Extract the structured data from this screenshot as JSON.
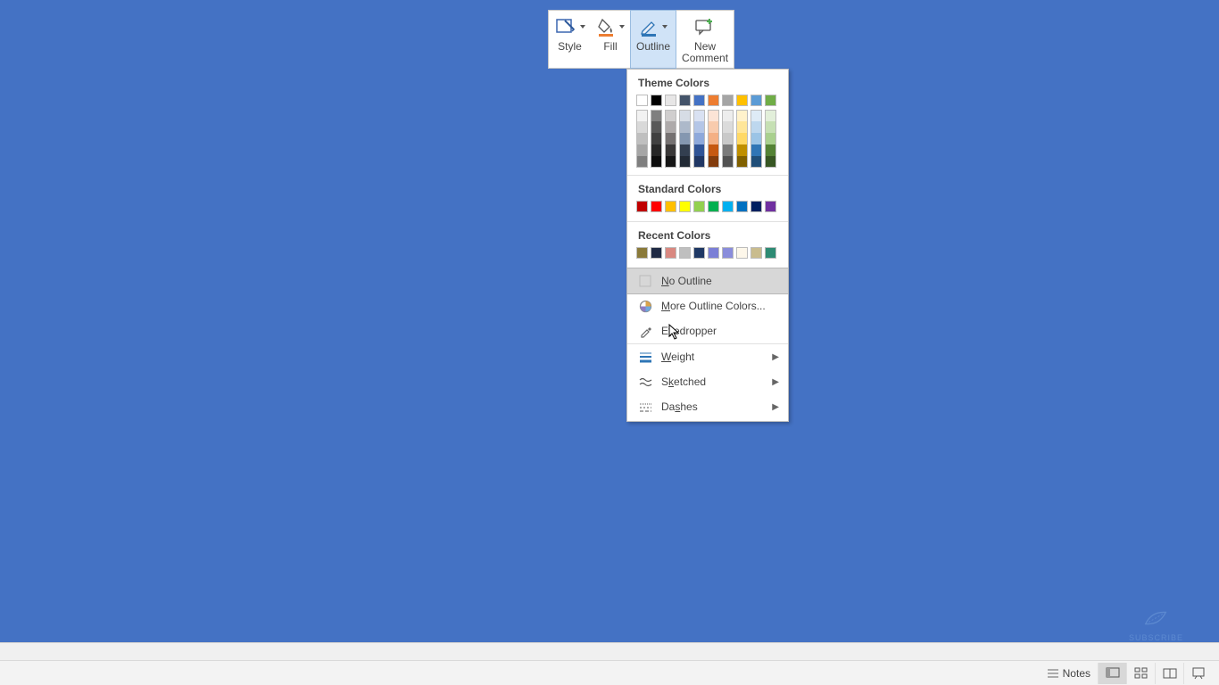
{
  "toolbar": {
    "style": {
      "label": "Style"
    },
    "fill": {
      "label": "Fill",
      "accent": "#ed7d31"
    },
    "outline": {
      "label": "Outline",
      "accent": "#2e75b6"
    },
    "new_comment": {
      "label": "New\nComment"
    }
  },
  "dropdown": {
    "theme_title": "Theme Colors",
    "theme_row": [
      "#ffffff",
      "#000000",
      "#e7e6e6",
      "#44546a",
      "#4472c4",
      "#ed7d31",
      "#a5a5a5",
      "#ffc000",
      "#5b9bd5",
      "#70ad47"
    ],
    "theme_shades": [
      [
        "#f2f2f2",
        "#d9d9d9",
        "#bfbfbf",
        "#a6a6a6",
        "#7f7f7f"
      ],
      [
        "#7f7f7f",
        "#595959",
        "#404040",
        "#262626",
        "#0d0d0d"
      ],
      [
        "#d0cece",
        "#aeaaaa",
        "#757171",
        "#3a3838",
        "#161616"
      ],
      [
        "#d6dce5",
        "#adb9ca",
        "#8497b0",
        "#333f50",
        "#222a35"
      ],
      [
        "#d9e1f2",
        "#b4c6e7",
        "#8ea9db",
        "#305496",
        "#203764"
      ],
      [
        "#fce4d6",
        "#f8cbad",
        "#f4b084",
        "#c65911",
        "#833c0c"
      ],
      [
        "#ededed",
        "#dbdbdb",
        "#c9c9c9",
        "#7b7b7b",
        "#525252"
      ],
      [
        "#fff2cc",
        "#ffe699",
        "#ffd966",
        "#bf8f00",
        "#806000"
      ],
      [
        "#deebf6",
        "#bdd7ee",
        "#9bc4e6",
        "#2f75b5",
        "#1f4e78"
      ],
      [
        "#e2efda",
        "#c6e0b4",
        "#a9d08e",
        "#548235",
        "#375623"
      ]
    ],
    "standard_title": "Standard Colors",
    "standard_row": [
      "#c00000",
      "#ff0000",
      "#ffc000",
      "#ffff00",
      "#92d050",
      "#00b050",
      "#00b0f0",
      "#0070c0",
      "#002060",
      "#7030a0"
    ],
    "recent_title": "Recent Colors",
    "recent_row": [
      "#8a7a3a",
      "#1f2a44",
      "#d98880",
      "#bfbfbf",
      "#1f3864",
      "#7b7fd6",
      "#8a8ddb",
      "#fdf7ea",
      "#c9bc8e",
      "#2e8b74"
    ],
    "no_outline": "No Outline",
    "more_colors": "More Outline Colors...",
    "eyedropper": "Eyedropper",
    "weight": "Weight",
    "sketched": "Sketched",
    "dashes": "Dashes"
  },
  "statusbar": {
    "notes": "Notes"
  },
  "watermark": {
    "text": "SUBSCRIBE"
  }
}
